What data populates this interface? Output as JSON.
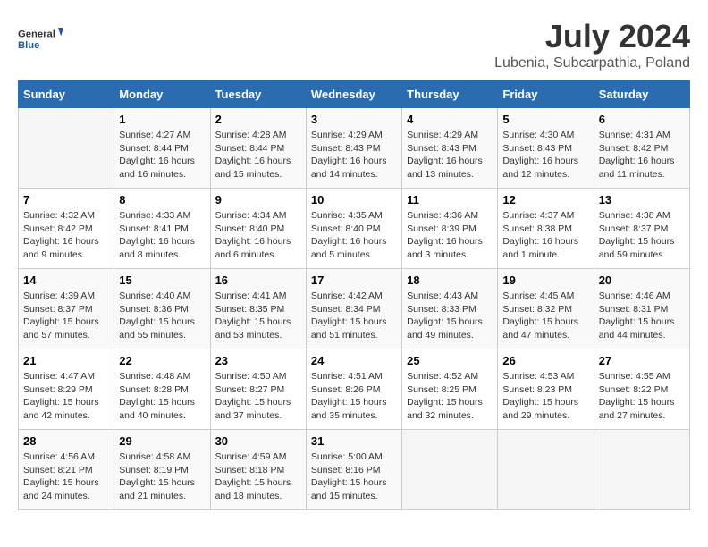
{
  "header": {
    "logo_general": "General",
    "logo_blue": "Blue",
    "month": "July 2024",
    "location": "Lubenia, Subcarpathia, Poland"
  },
  "days_of_week": [
    "Sunday",
    "Monday",
    "Tuesday",
    "Wednesday",
    "Thursday",
    "Friday",
    "Saturday"
  ],
  "weeks": [
    [
      {
        "day": "",
        "info": ""
      },
      {
        "day": "1",
        "info": "Sunrise: 4:27 AM\nSunset: 8:44 PM\nDaylight: 16 hours\nand 16 minutes."
      },
      {
        "day": "2",
        "info": "Sunrise: 4:28 AM\nSunset: 8:44 PM\nDaylight: 16 hours\nand 15 minutes."
      },
      {
        "day": "3",
        "info": "Sunrise: 4:29 AM\nSunset: 8:43 PM\nDaylight: 16 hours\nand 14 minutes."
      },
      {
        "day": "4",
        "info": "Sunrise: 4:29 AM\nSunset: 8:43 PM\nDaylight: 16 hours\nand 13 minutes."
      },
      {
        "day": "5",
        "info": "Sunrise: 4:30 AM\nSunset: 8:43 PM\nDaylight: 16 hours\nand 12 minutes."
      },
      {
        "day": "6",
        "info": "Sunrise: 4:31 AM\nSunset: 8:42 PM\nDaylight: 16 hours\nand 11 minutes."
      }
    ],
    [
      {
        "day": "7",
        "info": "Sunrise: 4:32 AM\nSunset: 8:42 PM\nDaylight: 16 hours\nand 9 minutes."
      },
      {
        "day": "8",
        "info": "Sunrise: 4:33 AM\nSunset: 8:41 PM\nDaylight: 16 hours\nand 8 minutes."
      },
      {
        "day": "9",
        "info": "Sunrise: 4:34 AM\nSunset: 8:40 PM\nDaylight: 16 hours\nand 6 minutes."
      },
      {
        "day": "10",
        "info": "Sunrise: 4:35 AM\nSunset: 8:40 PM\nDaylight: 16 hours\nand 5 minutes."
      },
      {
        "day": "11",
        "info": "Sunrise: 4:36 AM\nSunset: 8:39 PM\nDaylight: 16 hours\nand 3 minutes."
      },
      {
        "day": "12",
        "info": "Sunrise: 4:37 AM\nSunset: 8:38 PM\nDaylight: 16 hours\nand 1 minute."
      },
      {
        "day": "13",
        "info": "Sunrise: 4:38 AM\nSunset: 8:37 PM\nDaylight: 15 hours\nand 59 minutes."
      }
    ],
    [
      {
        "day": "14",
        "info": "Sunrise: 4:39 AM\nSunset: 8:37 PM\nDaylight: 15 hours\nand 57 minutes."
      },
      {
        "day": "15",
        "info": "Sunrise: 4:40 AM\nSunset: 8:36 PM\nDaylight: 15 hours\nand 55 minutes."
      },
      {
        "day": "16",
        "info": "Sunrise: 4:41 AM\nSunset: 8:35 PM\nDaylight: 15 hours\nand 53 minutes."
      },
      {
        "day": "17",
        "info": "Sunrise: 4:42 AM\nSunset: 8:34 PM\nDaylight: 15 hours\nand 51 minutes."
      },
      {
        "day": "18",
        "info": "Sunrise: 4:43 AM\nSunset: 8:33 PM\nDaylight: 15 hours\nand 49 minutes."
      },
      {
        "day": "19",
        "info": "Sunrise: 4:45 AM\nSunset: 8:32 PM\nDaylight: 15 hours\nand 47 minutes."
      },
      {
        "day": "20",
        "info": "Sunrise: 4:46 AM\nSunset: 8:31 PM\nDaylight: 15 hours\nand 44 minutes."
      }
    ],
    [
      {
        "day": "21",
        "info": "Sunrise: 4:47 AM\nSunset: 8:29 PM\nDaylight: 15 hours\nand 42 minutes."
      },
      {
        "day": "22",
        "info": "Sunrise: 4:48 AM\nSunset: 8:28 PM\nDaylight: 15 hours\nand 40 minutes."
      },
      {
        "day": "23",
        "info": "Sunrise: 4:50 AM\nSunset: 8:27 PM\nDaylight: 15 hours\nand 37 minutes."
      },
      {
        "day": "24",
        "info": "Sunrise: 4:51 AM\nSunset: 8:26 PM\nDaylight: 15 hours\nand 35 minutes."
      },
      {
        "day": "25",
        "info": "Sunrise: 4:52 AM\nSunset: 8:25 PM\nDaylight: 15 hours\nand 32 minutes."
      },
      {
        "day": "26",
        "info": "Sunrise: 4:53 AM\nSunset: 8:23 PM\nDaylight: 15 hours\nand 29 minutes."
      },
      {
        "day": "27",
        "info": "Sunrise: 4:55 AM\nSunset: 8:22 PM\nDaylight: 15 hours\nand 27 minutes."
      }
    ],
    [
      {
        "day": "28",
        "info": "Sunrise: 4:56 AM\nSunset: 8:21 PM\nDaylight: 15 hours\nand 24 minutes."
      },
      {
        "day": "29",
        "info": "Sunrise: 4:58 AM\nSunset: 8:19 PM\nDaylight: 15 hours\nand 21 minutes."
      },
      {
        "day": "30",
        "info": "Sunrise: 4:59 AM\nSunset: 8:18 PM\nDaylight: 15 hours\nand 18 minutes."
      },
      {
        "day": "31",
        "info": "Sunrise: 5:00 AM\nSunset: 8:16 PM\nDaylight: 15 hours\nand 15 minutes."
      },
      {
        "day": "",
        "info": ""
      },
      {
        "day": "",
        "info": ""
      },
      {
        "day": "",
        "info": ""
      }
    ]
  ]
}
